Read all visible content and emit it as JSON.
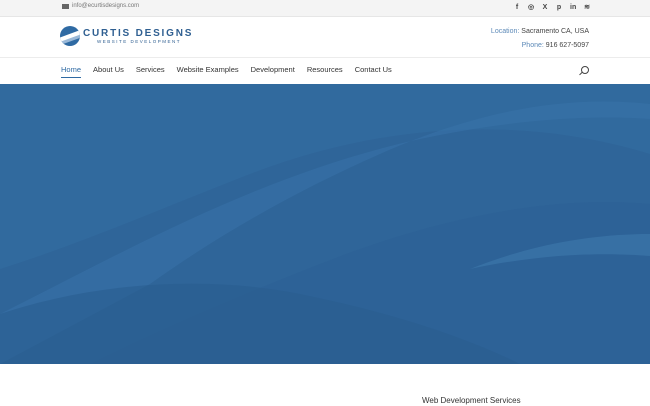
{
  "topbar": {
    "email": "info@ecurtisdesigns.com",
    "social_icons": [
      "facebook-icon",
      "instagram-icon",
      "x-icon",
      "pinterest-icon",
      "linkedin-icon",
      "rss-icon"
    ],
    "social_glyphs": [
      "f",
      "◎",
      "X",
      "p",
      "in",
      "≋"
    ]
  },
  "logo": {
    "name": "CURTIS DESIGNS",
    "tagline": "WEBSITE DEVELOPMENT",
    "color": "#2f5f91"
  },
  "contact": {
    "location_label": "Location:",
    "location_value": "Sacramento CA, USA",
    "phone_label": "Phone:",
    "phone_value": "916 627-5097"
  },
  "nav": {
    "items": [
      {
        "label": "Home",
        "active": true
      },
      {
        "label": "About Us"
      },
      {
        "label": "Services"
      },
      {
        "label": "Website Examples"
      },
      {
        "label": "Development"
      },
      {
        "label": "Resources"
      },
      {
        "label": "Contact Us"
      }
    ]
  },
  "hero": {
    "base_color": "#2f6599",
    "light_color": "#3b74aa",
    "dark_color": "#285a8c"
  },
  "section": {
    "heading": "Web Development Services"
  }
}
